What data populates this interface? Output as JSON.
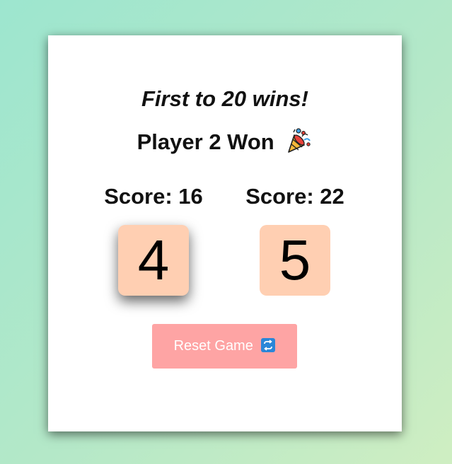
{
  "game": {
    "goal_text": "First to 20 wins!",
    "status_text": "Player 2 Won",
    "status_icon": "party-popper-icon",
    "players": [
      {
        "score_label": "Score: 16",
        "die_value": "4",
        "active": true
      },
      {
        "score_label": "Score: 22",
        "die_value": "5",
        "active": false
      }
    ],
    "reset_label": "Reset Game",
    "reset_icon": "repeat-icon"
  },
  "colors": {
    "background_start": "#9de6cf",
    "background_end": "#cfeec2",
    "card": "#ffffff",
    "die": "#ffcfb2",
    "button": "#fea4a4",
    "button_text": "#ffffff"
  }
}
